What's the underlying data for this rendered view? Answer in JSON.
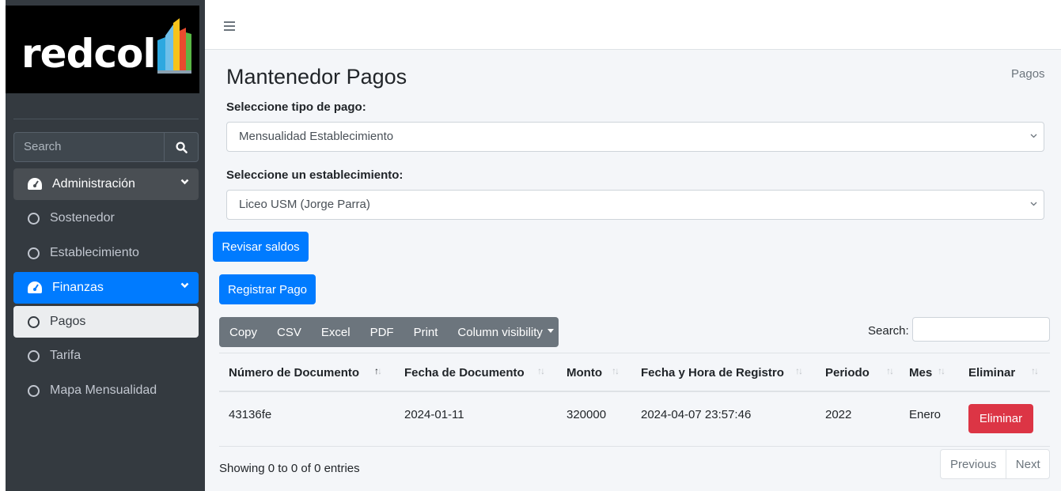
{
  "brand": {
    "name": "redcol"
  },
  "sidebar": {
    "search_placeholder": "Search",
    "items": [
      {
        "label": "Administración",
        "type": "parent",
        "icon": "tachometer-icon"
      },
      {
        "label": "Sostenedor"
      },
      {
        "label": "Establecimiento"
      },
      {
        "label": "Finanzas",
        "type": "parent",
        "icon": "tachometer-icon",
        "active": true
      },
      {
        "label": "Pagos",
        "active": true
      },
      {
        "label": "Tarifa"
      },
      {
        "label": "Mapa Mensualidad"
      }
    ]
  },
  "header": {
    "title": "Mantenedor Pagos",
    "breadcrumb": "Pagos"
  },
  "form": {
    "payment_type_label": "Seleccione tipo de pago:",
    "payment_type_value": "Mensualidad Establecimiento",
    "school_label": "Seleccione un establecimiento:",
    "school_value": "Liceo USM (Jorge Parra)"
  },
  "buttons": {
    "revisar": "Revisar saldos",
    "registrar": "Registrar Pago",
    "eliminar": "Eliminar"
  },
  "export": {
    "copy": "Copy",
    "csv": "CSV",
    "excel": "Excel",
    "pdf": "PDF",
    "print": "Print",
    "colvis": "Column visibility"
  },
  "table": {
    "search_label": "Search:",
    "columns": [
      "Número de Documento",
      "Fecha de Documento",
      "Monto",
      "Fecha y Hora de Registro",
      "Periodo",
      "Mes",
      "Eliminar"
    ],
    "rows": [
      {
        "documento": "43136fe",
        "fecha": "2024-01-11",
        "monto": "320000",
        "registro": "2024-04-07 23:57:46",
        "periodo": "2022",
        "mes": "Enero"
      }
    ],
    "info": "Showing 0 to 0 of 0 entries",
    "prev": "Previous",
    "next": "Next"
  },
  "colors": {
    "primary": "#007bff",
    "danger": "#dc3545",
    "sidebar": "#343a40",
    "secondary": "#6c757d"
  }
}
